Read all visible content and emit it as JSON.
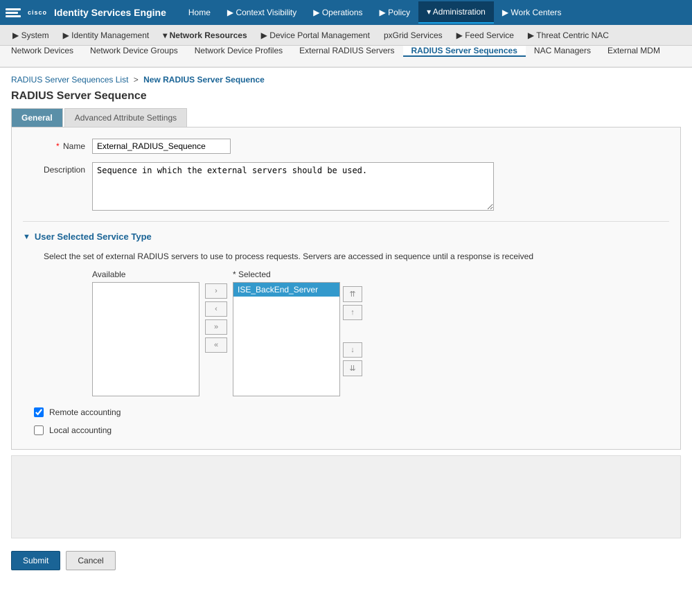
{
  "app": {
    "logo_text": "cisco",
    "title": "Identity Services Engine"
  },
  "top_nav": {
    "items": [
      {
        "label": "Home",
        "active": false
      },
      {
        "label": "▶ Context Visibility",
        "active": false
      },
      {
        "label": "▶ Operations",
        "active": false
      },
      {
        "label": "▶ Policy",
        "active": false
      },
      {
        "label": "▾ Administration",
        "active": true
      },
      {
        "label": "▶ Work Centers",
        "active": false
      }
    ]
  },
  "second_nav": {
    "items": [
      {
        "label": "▶ System"
      },
      {
        "label": "▶ Identity Management"
      },
      {
        "label": "▾ Network Resources",
        "active": true
      },
      {
        "label": "▶ Device Portal Management"
      },
      {
        "label": "pxGrid Services"
      },
      {
        "label": "▶ Feed Service"
      },
      {
        "label": "▶ Threat Centric NAC"
      }
    ]
  },
  "third_nav": {
    "items": [
      {
        "label": "Network Devices",
        "active": false
      },
      {
        "label": "Network Device Groups",
        "active": false
      },
      {
        "label": "Network Device Profiles",
        "active": false
      },
      {
        "label": "External RADIUS Servers",
        "active": false
      },
      {
        "label": "RADIUS Server Sequences",
        "active": true
      },
      {
        "label": "NAC Managers",
        "active": false
      },
      {
        "label": "External MDM",
        "active": false
      }
    ]
  },
  "breadcrumb": {
    "list_link": "RADIUS Server Sequences List",
    "separator": ">",
    "current": "New RADIUS Server Sequence"
  },
  "page": {
    "title": "RADIUS Server Sequence",
    "tabs": [
      {
        "label": "General",
        "active": true
      },
      {
        "label": "Advanced Attribute Settings",
        "active": false
      }
    ]
  },
  "form": {
    "name_label": "Name",
    "name_required": "*",
    "name_value": "External_RADIUS_Sequence",
    "description_label": "Description",
    "description_value": "Sequence in which the external servers should be used."
  },
  "section": {
    "title": "User Selected Service Type",
    "toggle": "▼",
    "description": "Select the set of external RADIUS servers to use to process requests. Servers are accessed in sequence until a response is received",
    "available_label": "Available",
    "selected_label": "* Selected",
    "selected_items": [
      "ISE_BackEnd_Server"
    ],
    "available_items": []
  },
  "buttons": {
    "move_right": "›",
    "move_left": "‹",
    "move_all_right": "»",
    "move_all_left": "«",
    "move_top": "⇈",
    "move_up": "↑",
    "move_down": "↓",
    "move_bottom": "⇊",
    "submit": "Submit",
    "cancel": "Cancel"
  },
  "checkboxes": {
    "remote_accounting": {
      "label": "Remote accounting",
      "checked": true
    },
    "local_accounting": {
      "label": "Local accounting",
      "checked": false
    }
  }
}
